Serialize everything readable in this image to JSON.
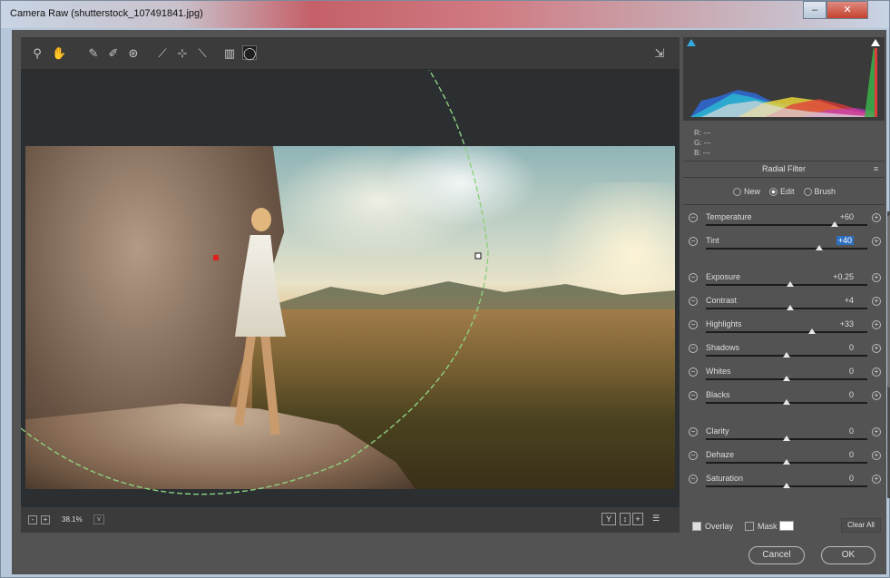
{
  "window": {
    "title": "Camera Raw (shutterstock_107491841.jpg)"
  },
  "toolbar": {
    "tools": [
      {
        "icon": "zoom-icon",
        "glyph": "⚲"
      },
      {
        "icon": "hand-icon",
        "glyph": "✋"
      },
      {
        "icon": "white-balance-icon",
        "glyph": "✎"
      },
      {
        "icon": "color-sampler-icon",
        "glyph": "✐"
      },
      {
        "icon": "targeted-adjustment-icon",
        "glyph": "⊛"
      },
      {
        "icon": "straighten-icon",
        "glyph": "⟋"
      },
      {
        "icon": "spot-removal-icon",
        "glyph": "⊹"
      },
      {
        "icon": "adjustment-brush-icon",
        "glyph": "⟍"
      },
      {
        "icon": "graduated-filter-icon",
        "glyph": "▥"
      },
      {
        "icon": "radial-filter-icon",
        "glyph": "◯"
      }
    ],
    "export_icon": "⇲"
  },
  "status": {
    "zoom_minus": "-",
    "zoom_plus": "+",
    "zoom_value": "38.1%",
    "zoom_dropdown": "v",
    "before_after": "Y",
    "swap": "↕",
    "copy": "+",
    "settings": "☰"
  },
  "histogram": {
    "rgb_labels": [
      "R:",
      "G:",
      "B:"
    ],
    "rgb_values": [
      "---",
      "---",
      "---"
    ],
    "colors": {
      "red": "#e03a3a",
      "green": "#3ab34a",
      "blue": "#2f6ad8",
      "yellow": "#e8d33a",
      "magenta": "#c23ad8",
      "cyan": "#2ad8d8"
    }
  },
  "panel": {
    "title": "Radial Filter",
    "menu_icon": "≡",
    "modes": [
      "New",
      "Edit",
      "Brush"
    ],
    "selected_mode": "Edit",
    "sliders": [
      {
        "label": "Temperature",
        "value": "+60",
        "pos": 0.8
      },
      {
        "label": "Tint",
        "value": "+40",
        "pos": 0.7,
        "highlight": true
      },
      {
        "label": "Exposure",
        "value": "+0.25",
        "pos": 0.52
      },
      {
        "label": "Contrast",
        "value": "+4",
        "pos": 0.52
      },
      {
        "label": "Highlights",
        "value": "+33",
        "pos": 0.66
      },
      {
        "label": "Shadows",
        "value": "0",
        "pos": 0.5
      },
      {
        "label": "Whites",
        "value": "0",
        "pos": 0.5
      },
      {
        "label": "Blacks",
        "value": "0",
        "pos": 0.5
      },
      {
        "label": "Clarity",
        "value": "0",
        "pos": 0.5
      },
      {
        "label": "Dehaze",
        "value": "0",
        "pos": 0.5
      },
      {
        "label": "Saturation",
        "value": "0",
        "pos": 0.5
      }
    ],
    "overlay_label": "Overlay",
    "mask_label": "Mask",
    "clear_label": "Clear All"
  },
  "footer": {
    "cancel": "Cancel",
    "ok": "OK"
  }
}
